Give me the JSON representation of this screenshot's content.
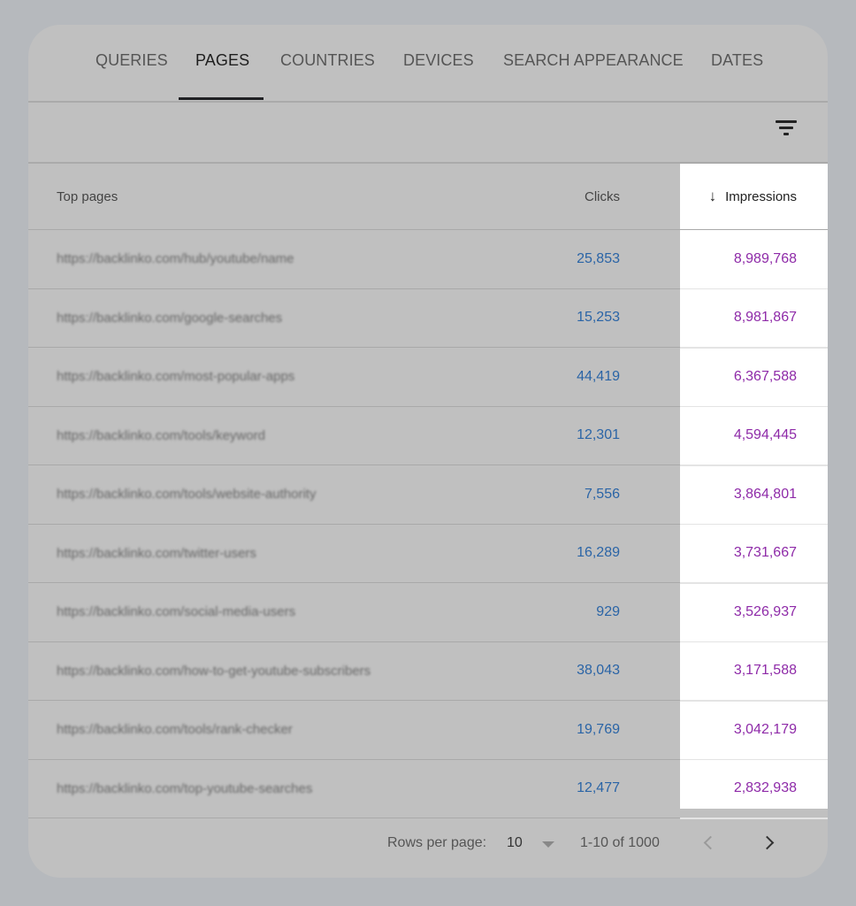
{
  "tabs": [
    {
      "label": "QUERIES",
      "active": false
    },
    {
      "label": "PAGES",
      "active": true
    },
    {
      "label": "COUNTRIES",
      "active": false
    },
    {
      "label": "DEVICES",
      "active": false
    },
    {
      "label": "SEARCH APPEARANCE",
      "active": false
    },
    {
      "label": "DATES",
      "active": false
    }
  ],
  "filter": {
    "icon": "filter-icon"
  },
  "table": {
    "headers": {
      "page": "Top pages",
      "clicks": "Clicks",
      "impressions": "Impressions",
      "sort_icon": "arrow-down-icon"
    },
    "rows": [
      {
        "page": "https://backlinko.com/hub/youtube/name",
        "clicks": "25,853",
        "impressions": "8,989,768"
      },
      {
        "page": "https://backlinko.com/google-searches",
        "clicks": "15,253",
        "impressions": "8,981,867"
      },
      {
        "page": "https://backlinko.com/most-popular-apps",
        "clicks": "44,419",
        "impressions": "6,367,588"
      },
      {
        "page": "https://backlinko.com/tools/keyword",
        "clicks": "12,301",
        "impressions": "4,594,445"
      },
      {
        "page": "https://backlinko.com/tools/website-authority",
        "clicks": "7,556",
        "impressions": "3,864,801"
      },
      {
        "page": "https://backlinko.com/twitter-users",
        "clicks": "16,289",
        "impressions": "3,731,667"
      },
      {
        "page": "https://backlinko.com/social-media-users",
        "clicks": "929",
        "impressions": "3,526,937"
      },
      {
        "page": "https://backlinko.com/how-to-get-youtube-subscribers",
        "clicks": "38,043",
        "impressions": "3,171,588"
      },
      {
        "page": "https://backlinko.com/tools/rank-checker",
        "clicks": "19,769",
        "impressions": "3,042,179"
      },
      {
        "page": "https://backlinko.com/top-youtube-searches",
        "clicks": "12,477",
        "impressions": "2,832,938"
      }
    ]
  },
  "pagination": {
    "rows_per_page_label": "Rows per page:",
    "rows_per_page_value": "10",
    "range": "1-10 of 1000"
  },
  "colors": {
    "clicks": "#2a64a6",
    "impressions": "#8e2aa8",
    "background": "#c0c0c0",
    "highlight": "#ffffff"
  }
}
